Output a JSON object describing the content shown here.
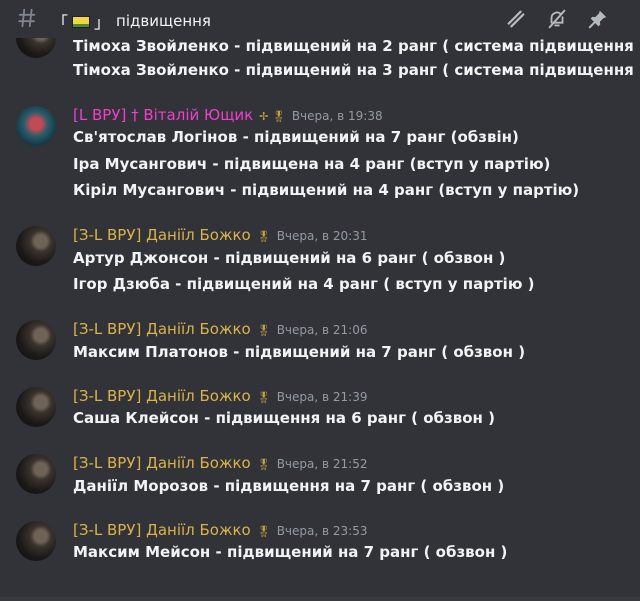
{
  "header": {
    "bracket_open": "「",
    "bracket_close": "」",
    "channel_name": "підвищення",
    "icons": [
      "hash-icon",
      "threads-icon",
      "mute-bell-icon",
      "pin-icon"
    ]
  },
  "partial_line": "Тімоха Звойленко - підвищений на 2 ранг ( система підвищення )",
  "groups": [
    {
      "author": "",
      "time": "",
      "lines": [
        "Тімоха Звойленко - підвищений на 3 ранг ( система підвищення )"
      ]
    },
    {
      "author": "[L ВРУ] † Віталій Ющик",
      "badge": "✢ 🎖",
      "time": "Вчера, в 19:38",
      "lines": [
        "Св'ятослав Логінов - підвищений на 7 ранг (обзвін)",
        "Іра Мусангович - підвищена на 4 ранг (вступ у партію)",
        "Кіріл Мусангович - підвищений на 4 ранг (вступ у партію)"
      ]
    },
    {
      "author": "[З-L ВРУ] Даніїл Божко",
      "badge": "🎖",
      "time": "Вчера, в 20:31",
      "lines": [
        "Артур Джонсон - підвищений на 6 ранг ( обзвон )",
        "Ігор Дзюба - підвищений на 4 ранг ( вступ у партію )"
      ]
    },
    {
      "author": "[З-L ВРУ] Даніїл Божко",
      "badge": "🎖",
      "time": "Вчера, в 21:06",
      "lines": [
        "Максим Платонов - підвищений на 7 ранг ( обзвон )"
      ]
    },
    {
      "author": "[З-L ВРУ] Даніїл Божко",
      "badge": "🎖",
      "time": "Вчера, в 21:39",
      "lines": [
        "Саша Клейсон - підвищення на 6 ранг ( обзвон )"
      ]
    },
    {
      "author": "[З-L ВРУ] Даніїл Божко",
      "badge": "🎖",
      "time": "Вчера, в 21:52",
      "lines": [
        "Даніїл Морозов - підвищення на 7 ранг ( обзвон )"
      ]
    },
    {
      "author": "[З-L ВРУ] Даніїл Божко",
      "badge": "🎖",
      "time": "Вчера, в 23:53",
      "lines": [
        "Максим Мейсон - підвищений на 7 ранг ( обзвон )"
      ]
    }
  ]
}
